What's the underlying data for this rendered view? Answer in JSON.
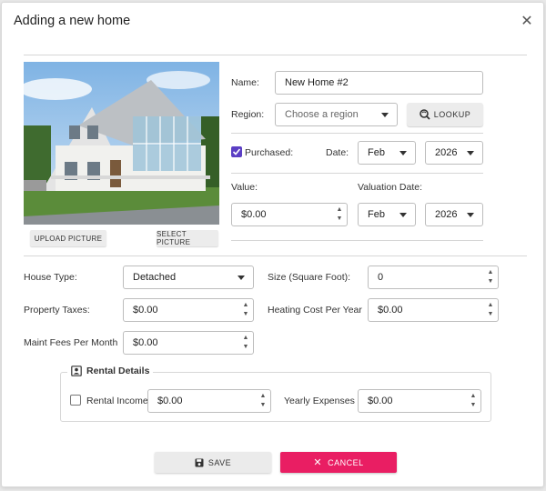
{
  "dialog": {
    "title": "Adding a new home",
    "close_icon": "close-icon"
  },
  "picture": {
    "upload_label": "UPLOAD PICTURE",
    "select_label": "SELECT PICTURE"
  },
  "form": {
    "name_label": "Name:",
    "name_value": "New Home #2",
    "region_label": "Region:",
    "region_placeholder": "Choose a region",
    "lookup_label": "LOOKUP",
    "purchased_label": "Purchased:",
    "purchased_checked": true,
    "date_label": "Date:",
    "purchase_month": "Feb",
    "purchase_year": "2026",
    "value_label": "Value:",
    "value_amount": "$0.00",
    "valuation_date_label": "Valuation Date:",
    "valuation_month": "Feb",
    "valuation_year": "2026",
    "house_type_label": "House Type:",
    "house_type_value": "Detached",
    "size_label": "Size (Square Foot):",
    "size_value": "0",
    "property_taxes_label": "Property Taxes:",
    "property_taxes_value": "$0.00",
    "heating_label": "Heating Cost Per Year",
    "heating_value": "$0.00",
    "maint_label": "Maint Fees Per Month",
    "maint_value": "$0.00"
  },
  "rental": {
    "legend": "Rental Details",
    "income_label": "Rental Income",
    "income_checked": false,
    "income_value": "$0.00",
    "expenses_label": "Yearly Expenses",
    "expenses_value": "$0.00"
  },
  "actions": {
    "save_label": "SAVE",
    "cancel_label": "CANCEL"
  },
  "colors": {
    "accent": "#e91e63",
    "checkbox": "#5b3fc4"
  }
}
